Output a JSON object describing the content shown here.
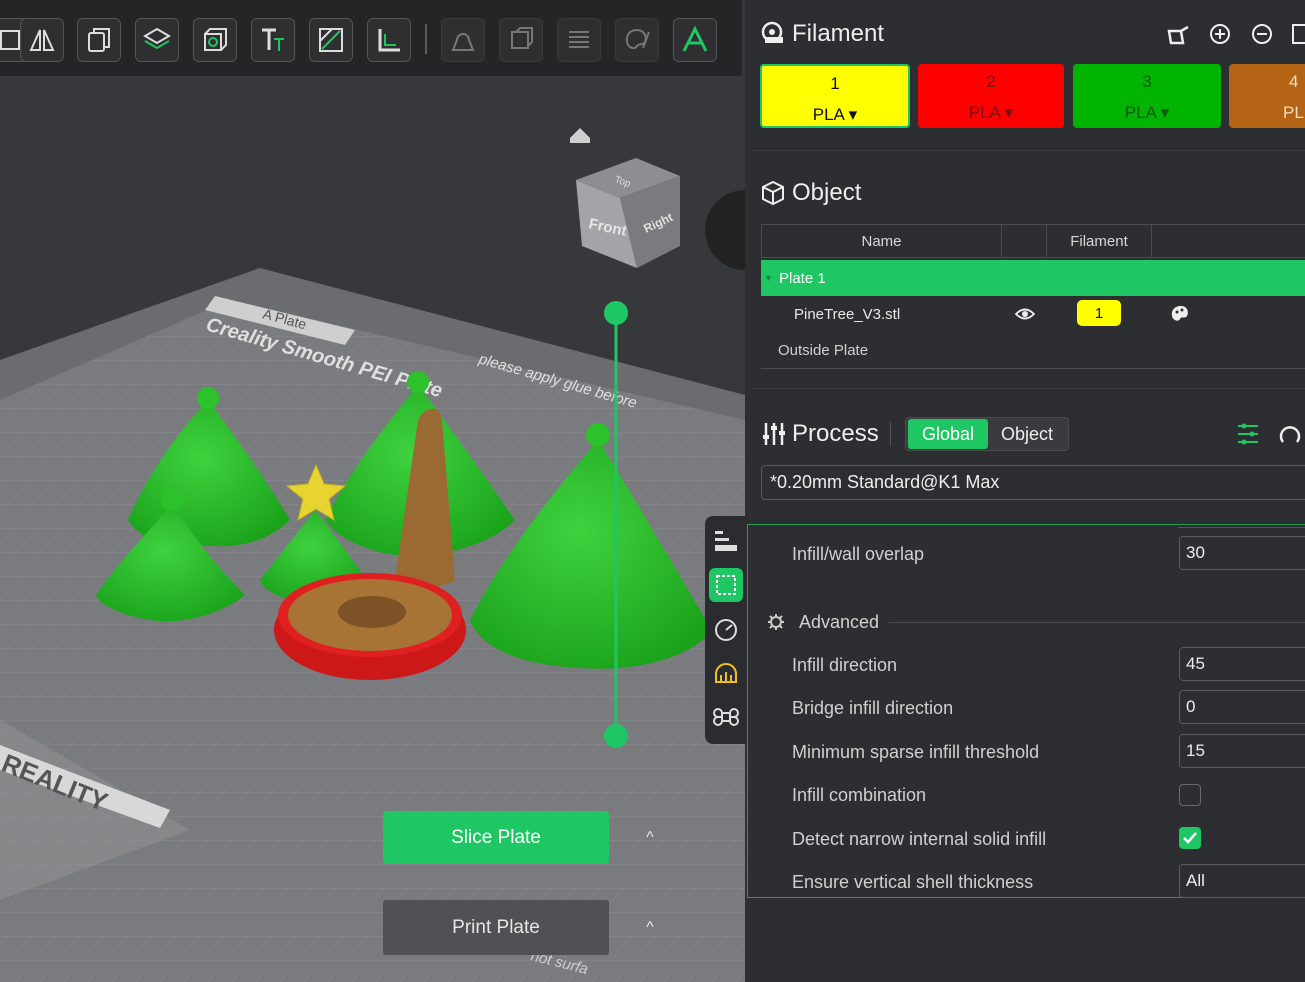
{
  "toolbar": {
    "buttons": [
      "mirror-icon",
      "copy-icon",
      "layers-icon",
      "cube-icon",
      "text-icon",
      "cut-icon",
      "measure-icon",
      "support-paint-icon",
      "seam-icon",
      "list-icon",
      "paint-icon",
      "assembly-icon"
    ]
  },
  "viewport": {
    "view_cube": {
      "top": "Top",
      "front": "Front",
      "right": "Right"
    },
    "plate_tab": "A Plate",
    "bed_text": "Creality Smooth PEI Plate",
    "bed_note": "please apply glue before",
    "bed_note2": "not surfa",
    "brand": "REALITY",
    "slice_label": "Slice Plate",
    "print_label": "Print Plate",
    "chevron": "^"
  },
  "filament": {
    "title": "Filament",
    "items": [
      {
        "num": "1",
        "material": "PLA ▾",
        "color": "#ffff00",
        "text": "#111111"
      },
      {
        "num": "2",
        "material": "PLA ▾",
        "color": "#ff0000",
        "text": "#7a1010"
      },
      {
        "num": "3",
        "material": "PLA ▾",
        "color": "#00b400",
        "text": "#0a5a0a"
      },
      {
        "num": "4",
        "material": "PL",
        "color": "#b46414",
        "text": "#f0e0c8"
      }
    ]
  },
  "object": {
    "title": "Object",
    "col_name": "Name",
    "col_filament": "Filament",
    "plate_row": "Plate 1",
    "item_name": "PineTree_V3.stl",
    "item_filament": "1",
    "outside": "Outside Plate"
  },
  "process": {
    "title": "Process",
    "tab_global": "Global",
    "tab_object": "Object",
    "preset": "*0.20mm Standard@K1 Max",
    "advanced": "Advanced",
    "settings": [
      {
        "label": "Infill/wall overlap",
        "value": "30",
        "type": "input"
      },
      {
        "label": "Infill direction",
        "value": "45",
        "type": "input"
      },
      {
        "label": "Bridge infill direction",
        "value": "0",
        "type": "input"
      },
      {
        "label": "Minimum sparse infill threshold",
        "value": "15",
        "type": "input"
      },
      {
        "label": "Infill combination",
        "value": "",
        "type": "checkbox",
        "checked": false
      },
      {
        "label": "Detect narrow internal solid infill",
        "value": "",
        "type": "checkbox",
        "checked": true
      },
      {
        "label": "Ensure vertical shell thickness",
        "value": "All",
        "type": "input"
      }
    ]
  },
  "colors": {
    "accent": "#1fc764",
    "panel": "#2d2e31",
    "viewport": "#37383b"
  }
}
